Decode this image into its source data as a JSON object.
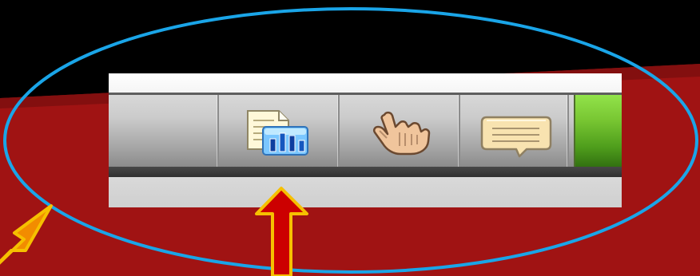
{
  "screen": {
    "background_color": "#000000",
    "surface_color": "#a01313"
  },
  "annotation": {
    "ellipse_color": "#1aa5e8",
    "arrow_colors": [
      "#f28c00",
      "#cc0000"
    ]
  },
  "toolbar": {
    "button_icons": [
      "report-chart-icon",
      "hand-pointer-icon",
      "comment-bubble-icon"
    ],
    "green_tab_color": "#7cc434"
  }
}
